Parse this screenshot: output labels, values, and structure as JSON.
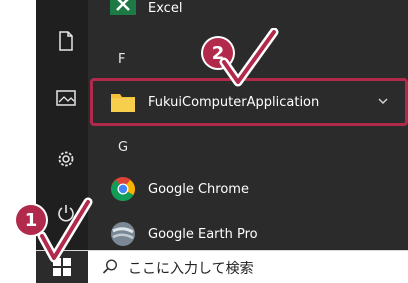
{
  "start_menu": {
    "rail": {
      "icons": [
        "document-icon",
        "pictures-icon",
        "settings-icon",
        "power-icon"
      ]
    },
    "apps": [
      {
        "label": "Excel",
        "icon": "excel-icon"
      },
      {
        "label": "FukuiComputerApplication",
        "icon": "folder-icon",
        "expandable": true
      },
      {
        "label": "Google Chrome",
        "icon": "chrome-icon"
      },
      {
        "label": "Google Earth Pro",
        "icon": "google-earth-icon"
      }
    ],
    "letters": [
      "F",
      "G"
    ]
  },
  "taskbar": {
    "search_text": "ここに入力して検索"
  },
  "annotations": {
    "step1": "1",
    "step2": "2"
  },
  "colors": {
    "accent": "#b1294b",
    "menu_bg": "#2b2b2b",
    "rail_bg": "#1f1f1f",
    "folder": "#f6c13a"
  }
}
